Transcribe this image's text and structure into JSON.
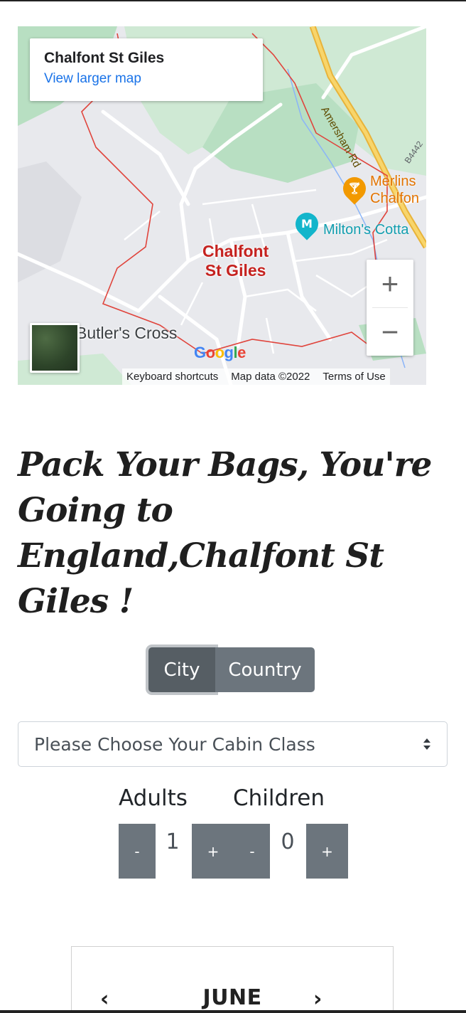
{
  "map": {
    "place_name": "Chalfont St Giles",
    "view_larger": "View larger map",
    "town_label_line1": "Chalfont",
    "town_label_line2": "St Giles",
    "poi_milton": "Milton's Cotta",
    "poi_merlins_line1": "Merlins",
    "poi_merlins_line2": "Chalfon",
    "butlers_cross": "Butler's Cross",
    "road_label": "Amersham Rd",
    "road_b": "B4442",
    "zoom_in": "+",
    "zoom_out": "−",
    "attribution": {
      "shortcuts": "Keyboard shortcuts",
      "data": "Map data ©2022",
      "terms": "Terms of Use"
    },
    "colors": {
      "boundary": "#e0443c",
      "road_major": "#f5c542",
      "green": "#b8dfc2"
    }
  },
  "heading": "Pack Your Bags, You're Going to England,Chalfont St Giles !",
  "trip_type": {
    "options": [
      "City",
      "Country"
    ],
    "selected": "City"
  },
  "cabin_select": {
    "placeholder": "Please Choose Your Cabin Class"
  },
  "passengers": {
    "adults_label": "Adults",
    "children_label": "Children",
    "adults_value": "1",
    "children_value": "0",
    "minus": "-",
    "plus": "+"
  },
  "calendar": {
    "month": "JUNE",
    "prev": "‹",
    "next": "›"
  }
}
